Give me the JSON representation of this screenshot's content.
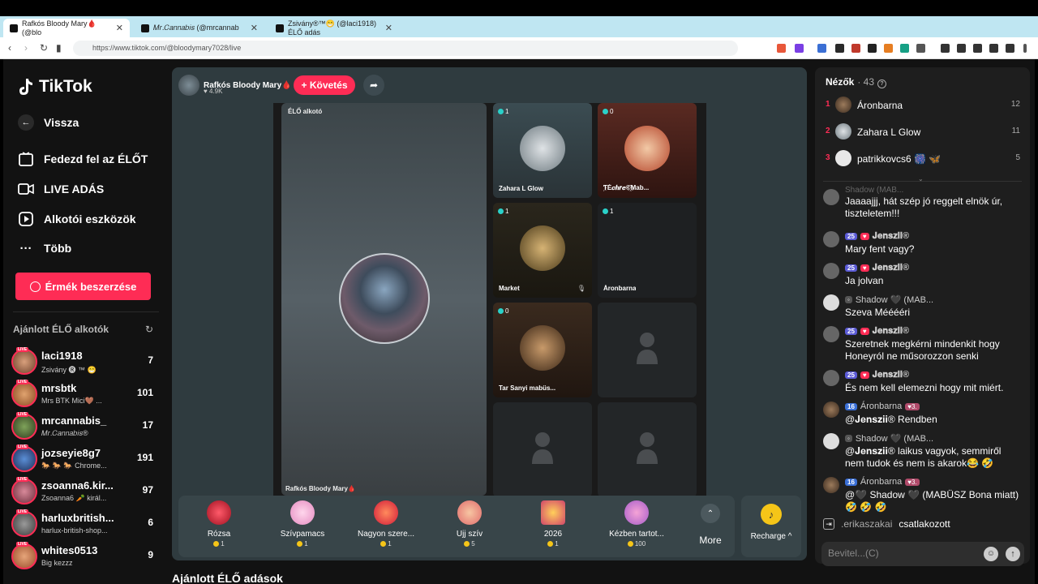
{
  "browser": {
    "tabs": [
      {
        "label": "Rafkós Bloody Mary🩸 (@blo"
      },
      {
        "label": "𝑀𝑟.𝐶𝑎𝑛𝑛𝑎𝑏𝑖𝑠 (@mrcannab"
      },
      {
        "label": "Zsivány®™😁 (@laci1918) ÉLŐ adás"
      }
    ],
    "url": "https://www.tiktok.com/@bloodymary7028/live"
  },
  "sidebar": {
    "logo": "TikTok",
    "back": "Vissza",
    "nav": [
      {
        "label": "Fedezd fel az ÉLŐT"
      },
      {
        "label": "LIVE ADÁS"
      },
      {
        "label": "Alkotói eszközök"
      },
      {
        "label": "Több"
      }
    ],
    "coins_button": "Érmék beszerzése",
    "recommended_title": "Ajánlott ÉLŐ alkotók",
    "live_badge": "LIVE",
    "creators": [
      {
        "name": "laci1918",
        "sub": "Zsivány 🅡 ™ 😁",
        "count": "7"
      },
      {
        "name": "mrsbtk",
        "sub": "Mrs BTK Mici🤎 ...",
        "count": "101"
      },
      {
        "name": "mrcannabis_",
        "sub": "𝑀𝑟.𝐶𝑎𝑛𝑛𝑎𝑏𝑖𝑠®",
        "count": "17"
      },
      {
        "name": "jozseyie8g7",
        "sub": "🐎 🐎 🐎 Chrome...",
        "count": "191"
      },
      {
        "name": "zsoanna6.kir...",
        "sub": "Zsoanna6 🥕 királ...",
        "count": "97"
      },
      {
        "name": "harluxbritish...",
        "sub": "harlux-british-shop...",
        "count": "6"
      },
      {
        "name": "whites0513",
        "sub": "Big kezzz",
        "count": "9"
      }
    ]
  },
  "stream": {
    "host_name": "Rafkós Bloody Mary🩸",
    "host_likes": "♥ 4.9K",
    "follow_label": "+ Követés",
    "main_label": "ÉLŐ alkotó",
    "main_bottom": "Rafkós Bloody Mary🩸",
    "slots": [
      {
        "badge": "1",
        "name": "Zahara L Glow"
      },
      {
        "badge": "0",
        "name": "҈ƬÉ𝒄𝒉𝒓𝒆©҈Mab..."
      },
      {
        "badge": "1",
        "name": "Market"
      },
      {
        "badge": "1",
        "name": "Áronbarna"
      },
      {
        "badge": "0",
        "name": "Tar Sanyi mabüs..."
      },
      {
        "badge": "",
        "name": ""
      },
      {
        "badge": "",
        "name": ""
      },
      {
        "badge": "",
        "name": ""
      }
    ]
  },
  "gifts": [
    {
      "name": "Rózsa",
      "price": "1"
    },
    {
      "name": "Szívpamacs",
      "price": "1"
    },
    {
      "name": "Nagyon szere...",
      "price": "1"
    },
    {
      "name": "Ujj szív",
      "price": "5"
    },
    {
      "name": "2026",
      "price": "1"
    },
    {
      "name": "Kézben tartot...",
      "price": "100"
    }
  ],
  "more_label": "More",
  "recharge_label": "Recharge ^",
  "recommended_heading": "Ajánlott ÉLŐ adások",
  "chat": {
    "viewers_title": "Nézők",
    "viewers_count": "· 43",
    "top_viewers": [
      {
        "rank": "1",
        "name": "Áronbarna",
        "score": "12"
      },
      {
        "rank": "2",
        "name": "Zahara L Glow",
        "score": "11"
      },
      {
        "rank": "3",
        "name": "patrikkovcs6 🎆 🦋",
        "score": "5"
      }
    ],
    "messages": [
      {
        "level": "",
        "user": "Shadow (MAB...",
        "text": "Jaaaajjj, hát szép jó reggelt elnök úr, tiszteletem!!!"
      },
      {
        "level": "25",
        "user": "𝐉𝐞𝐧𝐬𝐳𝐢𝐢®",
        "text": "Mary fent vagy?"
      },
      {
        "level": "25",
        "user": "𝐉𝐞𝐧𝐬𝐳𝐢𝐢®",
        "text": "Ja jolvan"
      },
      {
        "level": "",
        "user": "Shadow 🖤 (MAB...",
        "text": "Szeva Mééééri"
      },
      {
        "level": "25",
        "user": "𝐉𝐞𝐧𝐬𝐳𝐢𝐢®",
        "text": "Szeretnek megkérni mindenkit hogy Honeyról ne műsorozzon senki"
      },
      {
        "level": "25",
        "user": "𝐉𝐞𝐧𝐬𝐳𝐢𝐢®",
        "text": "És nem kell elemezni hogy mit miért."
      },
      {
        "level": "16",
        "user": "Áronbarna",
        "text": "@𝐉𝐞𝐧𝐬𝐳𝐢𝐢® Rendben"
      },
      {
        "level": "",
        "user": "Shadow 🖤 (MAB...",
        "text": "@𝐉𝐞𝐧𝐬𝐳𝐢𝐢® laikus vagyok, semmiről nem tudok és nem is akarok😂 🤣"
      },
      {
        "level": "16",
        "user": "Áronbarna",
        "text": "@🖤 Shadow 🖤 (MABÜSZ Bona miatt) 🤣 🤣 🤣"
      }
    ],
    "joined_user": ".erikaszakai",
    "joined_text": "csatlakozott",
    "input_placeholder": "Bevitel...(C)"
  }
}
